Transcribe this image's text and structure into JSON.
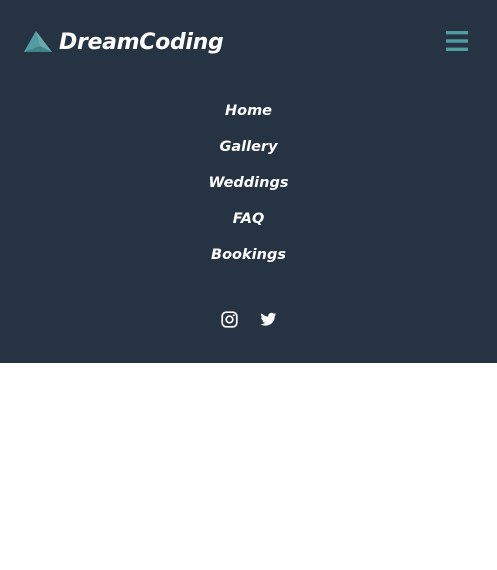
{
  "brand": {
    "name": "DreamCoding",
    "logo_icon": "paper-plane-icon"
  },
  "colors": {
    "navbar_bg": "#263343",
    "accent": "#4f9ca1",
    "text": "#ffffff",
    "page_bg": "#ffffff"
  },
  "menu_toggle": {
    "icon": "hamburger-icon"
  },
  "menu": {
    "items": [
      {
        "label": "Home"
      },
      {
        "label": "Gallery"
      },
      {
        "label": "Weddings"
      },
      {
        "label": "FAQ"
      },
      {
        "label": "Bookings"
      }
    ]
  },
  "social": {
    "items": [
      {
        "icon": "instagram-icon"
      },
      {
        "icon": "twitter-icon"
      }
    ]
  }
}
